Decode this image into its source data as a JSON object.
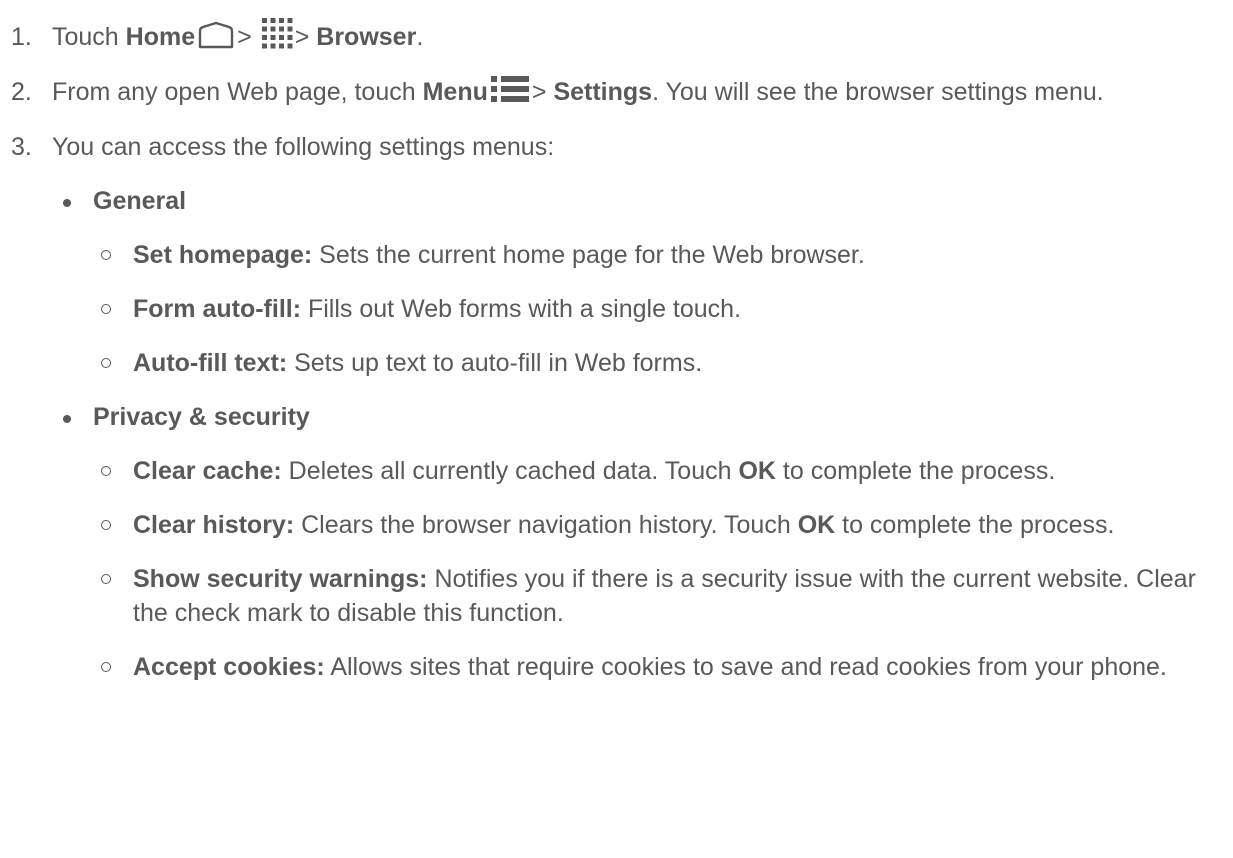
{
  "steps": [
    {
      "num": "1.",
      "text_touch": "Touch",
      "home": "Home",
      "sep1": ">",
      "sep2": ">",
      "browser": "Browser",
      "end": "."
    },
    {
      "num": "2.",
      "text_pre": "From any open Web page, touch",
      "menu": "Menu",
      "sep": ">",
      "settings": "Settings",
      "text_post": ". You will see the browser settings menu."
    },
    {
      "num": "3.",
      "text": "You can access the following settings menus:"
    }
  ],
  "sections": [
    {
      "title": "General",
      "items": [
        {
          "term": "Set homepage:",
          "desc": "Sets the current home page for the Web browser."
        },
        {
          "term": "Form auto-fill:",
          "desc": "Fills out Web forms with a single touch."
        },
        {
          "term": "Auto-fill text:",
          "desc": "Sets up text to auto-fill in Web forms."
        }
      ]
    },
    {
      "title": "Privacy & security",
      "items": [
        {
          "term": "Clear cache:",
          "desc": "Deletes all currently cached data. Touch",
          "bold": "OK",
          "desc_post": "to complete the process."
        },
        {
          "term": "Clear history:",
          "desc": "Clears the browser navigation history. Touch",
          "bold": "OK",
          "desc_post": "to complete the process."
        },
        {
          "term": "Show security warnings:",
          "desc": "Notifies you if there is a security issue with the current website. Clear the check mark to disable this function."
        },
        {
          "term": "Accept cookies:",
          "desc": "Allows sites that require cookies to save and read cookies from your phone."
        }
      ]
    }
  ],
  "icons": {
    "home": "home-icon",
    "apps": "apps-grid-icon",
    "menu": "menu-icon"
  }
}
